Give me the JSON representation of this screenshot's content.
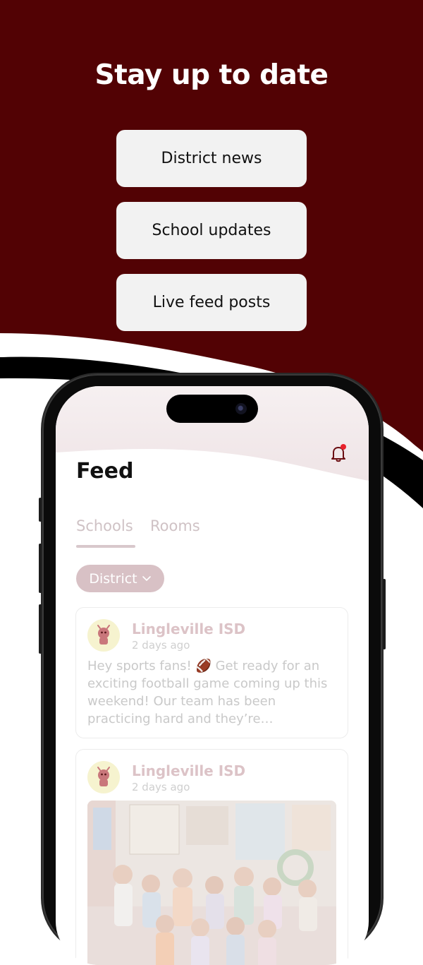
{
  "headline": "Stay up to date",
  "features": [
    "District news",
    "School updates",
    "Live feed posts"
  ],
  "app": {
    "title": "Feed",
    "tabs": [
      {
        "label": "Schools",
        "active": true
      },
      {
        "label": "Rooms",
        "active": false
      }
    ],
    "filter": {
      "selected": "District"
    },
    "posts": [
      {
        "author": "Lingleville ISD",
        "time": "2 days ago",
        "text": "Hey sports fans! 🏈 Get ready for an exciting football game coming up this weekend! Our team has been practicing hard and they’re…"
      },
      {
        "author": "Lingleville ISD",
        "time": "2 days ago",
        "text": ""
      }
    ]
  },
  "colors": {
    "brand": "#520204",
    "tab_muted": "#cfc2c5",
    "chip": "#d8c1c5",
    "notification_dot": "#e8212b"
  },
  "icons": {
    "notification": "bell-icon",
    "dropdown": "chevron-down-icon",
    "mascot": "mascot-avatar-icon"
  }
}
